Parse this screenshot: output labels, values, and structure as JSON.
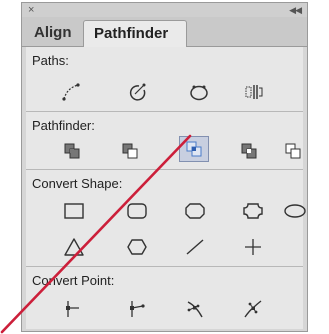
{
  "titlebar": {
    "close_icon": "×",
    "collapse_icon": "◀◀"
  },
  "tabs": [
    {
      "label": "Align",
      "active": false
    },
    {
      "label": "Pathfinder",
      "active": true
    }
  ],
  "sections": {
    "paths": {
      "label": "Paths:",
      "icons": [
        "join-icon",
        "outline-stroke-icon",
        "close-path-icon",
        "reverse-direction-icon"
      ]
    },
    "pathfinder": {
      "label": "Pathfinder:",
      "icons": [
        "unite-icon",
        "minus-front-icon",
        "intersect-icon",
        "exclude-icon",
        "divide-icon"
      ],
      "active_icon": "intersect-icon"
    },
    "convert_shape": {
      "label": "Convert Shape:",
      "icons": [
        "rectangle-icon",
        "rounded-rectangle-icon",
        "chamfer-rectangle-icon",
        "inverted-rounded-rectangle-icon",
        "ellipse-icon",
        "triangle-icon",
        "polygon-icon",
        "line-icon",
        "plus-icon"
      ]
    },
    "convert_point": {
      "label": "Convert Point:",
      "icons": [
        "plain-point-icon",
        "corner-point-icon",
        "smooth-point-icon",
        "symmetrical-point-icon"
      ]
    }
  },
  "colors": {
    "panel_bg": "#d6d6d6",
    "content_bg": "#e7e7e7",
    "active_button": "#c8cfe0",
    "annotation_line": "#cc1f3a",
    "icon_blue": "#4a7bc8"
  }
}
